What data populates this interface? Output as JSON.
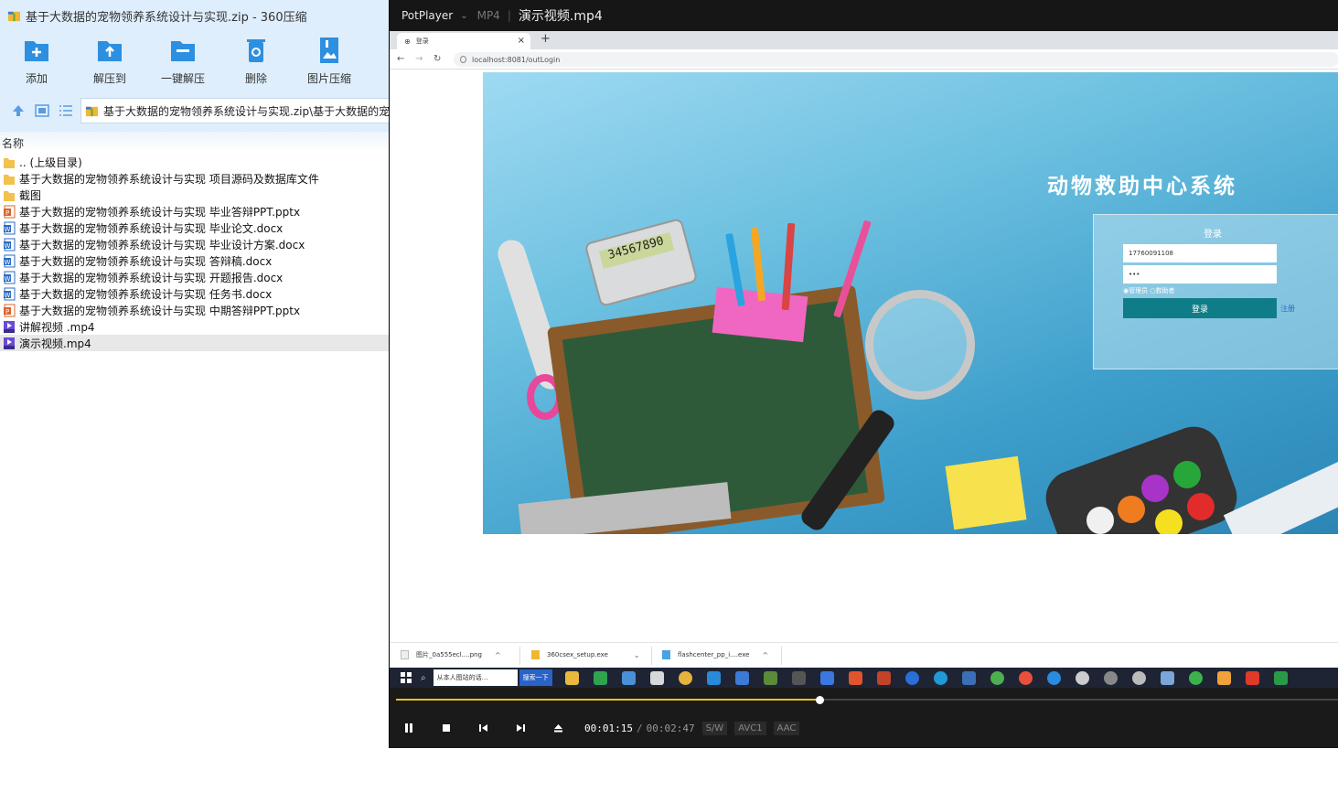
{
  "zip_window": {
    "title": "基于大数据的宠物领养系统设计与实现.zip - 360压缩",
    "toolbar": [
      {
        "label": "添加",
        "icon": "add-folder-icon"
      },
      {
        "label": "解压到",
        "icon": "extract-to-icon"
      },
      {
        "label": "一键解压",
        "icon": "one-click-extract-icon"
      },
      {
        "label": "删除",
        "icon": "trash-icon"
      },
      {
        "label": "图片压缩",
        "icon": "image-compress-icon"
      }
    ],
    "address": "基于大数据的宠物领养系统设计与实现.zip\\基于大数据的宠",
    "column_header": "名称",
    "files": [
      {
        "name": ".. (上级目录)",
        "type": "folder"
      },
      {
        "name": "基于大数据的宠物领养系统设计与实现 项目源码及数据库文件",
        "type": "folder"
      },
      {
        "name": "截图",
        "type": "folder"
      },
      {
        "name": "基于大数据的宠物领养系统设计与实现 毕业答辩PPT.pptx",
        "type": "pptx"
      },
      {
        "name": "基于大数据的宠物领养系统设计与实现 毕业论文.docx",
        "type": "docx"
      },
      {
        "name": "基于大数据的宠物领养系统设计与实现 毕业设计方案.docx",
        "type": "docx"
      },
      {
        "name": "基于大数据的宠物领养系统设计与实现 答辩稿.docx",
        "type": "docx"
      },
      {
        "name": "基于大数据的宠物领养系统设计与实现 开题报告.docx",
        "type": "docx"
      },
      {
        "name": "基于大数据的宠物领养系统设计与实现 任务书.docx",
        "type": "docx"
      },
      {
        "name": "基于大数据的宠物领养系统设计与实现 中期答辩PPT.pptx",
        "type": "pptx"
      },
      {
        "name": "讲解视频 .mp4",
        "type": "mp4"
      },
      {
        "name": "演示视频.mp4",
        "type": "mp4",
        "selected": true
      }
    ]
  },
  "player": {
    "brand": "PotPlayer",
    "format": "MP4",
    "title": "演示视频.mp4",
    "current_time": "00:01:15",
    "separator": "/",
    "total_time": "00:02:47",
    "badges": [
      "S/W",
      "AVC1",
      "AAC"
    ],
    "progress": 0.449,
    "accent": "#e6c21d"
  },
  "browser": {
    "tab_title": "登录",
    "url": "localhost:8081/outLogin",
    "page": {
      "system_title": "动物救助中心系统",
      "login_title": "登录",
      "username_value": "17760091108",
      "password_value": "•••",
      "role_option_1": "◉管理员",
      "role_option_2": "○救助者",
      "login_button": "登录",
      "register_link": "注册",
      "calc_display": "34567890"
    },
    "downloads": [
      "图片_0a555ecl....png",
      "360csex_setup.exe",
      "flashcenter_pp_i....exe"
    ],
    "taskbar_active": "从本人图站的话…",
    "taskbar_active2": "搜索一下"
  }
}
